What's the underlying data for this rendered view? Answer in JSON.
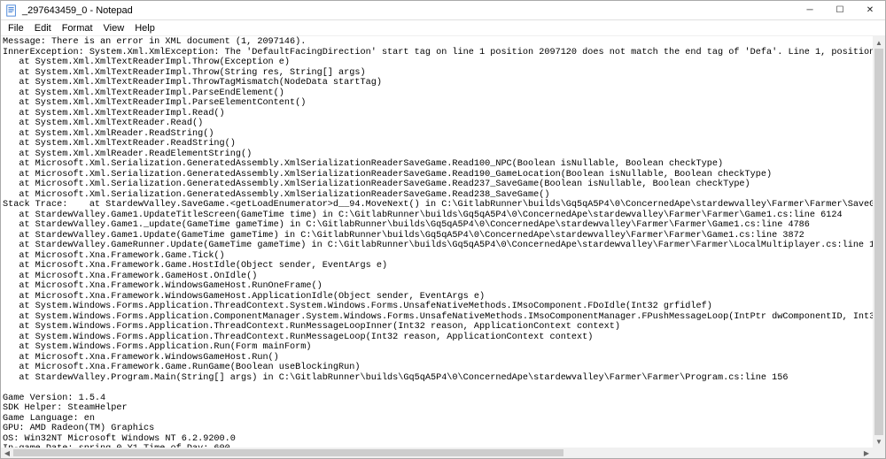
{
  "window": {
    "title": "_297643459_0 - Notepad",
    "minimize": "─",
    "maximize": "☐",
    "close": "✕"
  },
  "menu": {
    "file": "File",
    "edit": "Edit",
    "format": "Format",
    "view": "View",
    "help": "Help"
  },
  "body_text": "Message: There is an error in XML document (1, 2097146).\nInnerException: System.Xml.XmlException: The 'DefaultFacingDirection' start tag on line 1 position 2097120 does not match the end tag of 'Defa'. Line 1, position 2097146.\n   at System.Xml.XmlTextReaderImpl.Throw(Exception e)\n   at System.Xml.XmlTextReaderImpl.Throw(String res, String[] args)\n   at System.Xml.XmlTextReaderImpl.ThrowTagMismatch(NodeData startTag)\n   at System.Xml.XmlTextReaderImpl.ParseEndElement()\n   at System.Xml.XmlTextReaderImpl.ParseElementContent()\n   at System.Xml.XmlTextReaderImpl.Read()\n   at System.Xml.XmlTextReader.Read()\n   at System.Xml.XmlReader.ReadString()\n   at System.Xml.XmlTextReader.ReadString()\n   at System.Xml.XmlReader.ReadElementString()\n   at Microsoft.Xml.Serialization.GeneratedAssembly.XmlSerializationReaderSaveGame.Read100_NPC(Boolean isNullable, Boolean checkType)\n   at Microsoft.Xml.Serialization.GeneratedAssembly.XmlSerializationReaderSaveGame.Read190_GameLocation(Boolean isNullable, Boolean checkType)\n   at Microsoft.Xml.Serialization.GeneratedAssembly.XmlSerializationReaderSaveGame.Read237_SaveGame(Boolean isNullable, Boolean checkType)\n   at Microsoft.Xml.Serialization.GeneratedAssembly.XmlSerializationReaderSaveGame.Read238_SaveGame()\nStack Trace:    at StardewValley.SaveGame.<getLoadEnumerator>d__94.MoveNext() in C:\\GitlabRunner\\builds\\Gq5qA5P4\\0\\ConcernedApe\\stardewvalley\\Farmer\\Farmer\\SaveGame.cs:line 1428\n   at StardewValley.Game1.UpdateTitleScreen(GameTime time) in C:\\GitlabRunner\\builds\\Gq5qA5P4\\0\\ConcernedApe\\stardewvalley\\Farmer\\Farmer\\Game1.cs:line 6124\n   at StardewValley.Game1._update(GameTime gameTime) in C:\\GitlabRunner\\builds\\Gq5qA5P4\\0\\ConcernedApe\\stardewvalley\\Farmer\\Farmer\\Game1.cs:line 4786\n   at StardewValley.Game1.Update(GameTime gameTime) in C:\\GitlabRunner\\builds\\Gq5qA5P4\\0\\ConcernedApe\\stardewvalley\\Farmer\\Farmer\\Game1.cs:line 3872\n   at StardewValley.GameRunner.Update(GameTime gameTime) in C:\\GitlabRunner\\builds\\Gq5qA5P4\\0\\ConcernedApe\\stardewvalley\\Farmer\\Farmer\\LocalMultiplayer.cs:line 1046\n   at Microsoft.Xna.Framework.Game.Tick()\n   at Microsoft.Xna.Framework.Game.HostIdle(Object sender, EventArgs e)\n   at Microsoft.Xna.Framework.GameHost.OnIdle()\n   at Microsoft.Xna.Framework.WindowsGameHost.RunOneFrame()\n   at Microsoft.Xna.Framework.WindowsGameHost.ApplicationIdle(Object sender, EventArgs e)\n   at System.Windows.Forms.Application.ThreadContext.System.Windows.Forms.UnsafeNativeMethods.IMsoComponent.FDoIdle(Int32 grfidlef)\n   at System.Windows.Forms.Application.ComponentManager.System.Windows.Forms.UnsafeNativeMethods.IMsoComponentManager.FPushMessageLoop(IntPtr dwComponentID, Int32 reason, Int32 pvLoopData)\n   at System.Windows.Forms.Application.ThreadContext.RunMessageLoopInner(Int32 reason, ApplicationContext context)\n   at System.Windows.Forms.Application.ThreadContext.RunMessageLoop(Int32 reason, ApplicationContext context)\n   at System.Windows.Forms.Application.Run(Form mainForm)\n   at Microsoft.Xna.Framework.WindowsGameHost.Run()\n   at Microsoft.Xna.Framework.Game.RunGame(Boolean useBlockingRun)\n   at StardewValley.Program.Main(String[] args) in C:\\GitlabRunner\\builds\\Gq5qA5P4\\0\\ConcernedApe\\stardewvalley\\Farmer\\Farmer\\Program.cs:line 156\n\nGame Version: 1.5.4\nSDK Helper: SteamHelper\nGame Language: en\nGPU: AMD Radeon(TM) Graphics\nOS: Win32NT Microsoft Windows NT 6.2.9200.0\nIn-game Date: spring 0 Y1 Time of Day: 600\nGame Location: null"
}
